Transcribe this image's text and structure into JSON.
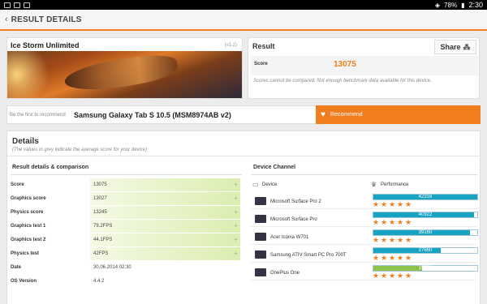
{
  "status": {
    "battery": "78%",
    "time": "2:30"
  },
  "appbar": {
    "title": "RESULT DETAILS"
  },
  "test": {
    "name": "Ice Storm Unlimited",
    "version": "(v1.2)"
  },
  "result": {
    "title": "Result",
    "share_label": "Share",
    "score_label": "Score",
    "score_value": "13075",
    "note": "Scores cannot be compared. Not enough benchmark data available for this device."
  },
  "recommend": {
    "first_text": "Be the first to recommend",
    "device": "Samsung Galaxy Tab S 10.5 (MSM8974AB v2)",
    "button": "Recommend"
  },
  "details": {
    "title": "Details",
    "subtitle": "(The values in grey indicate the average score for your device)",
    "left_heading": "Result details & comparison",
    "right_heading": "Device Channel",
    "rows": [
      {
        "label": "Score",
        "value": "13075",
        "green": true
      },
      {
        "label": "Graphics score",
        "value": "13027",
        "green": true
      },
      {
        "label": "Physics score",
        "value": "13245",
        "green": true
      },
      {
        "label": "Graphics test 1",
        "value": "79.2FPS",
        "green": true
      },
      {
        "label": "Graphics test 2",
        "value": "44.1FPS",
        "green": true
      },
      {
        "label": "Physics test",
        "value": "42FPS",
        "green": true
      },
      {
        "label": "Date",
        "value": "30.06.2014 02:30",
        "green": false
      },
      {
        "label": "OS Version",
        "value": "4.4.2",
        "green": false
      }
    ]
  },
  "device_channel": {
    "col_device": "Device",
    "col_perf": "Performance",
    "items": [
      {
        "name": "Microsoft Surface Pro 2",
        "score": "42316",
        "fill": 1.0,
        "color": "#19a3c2",
        "stars": 5
      },
      {
        "name": "Microsoft Surface Pro",
        "score": "40922",
        "fill": 0.97,
        "color": "#19a3c2",
        "stars": 5
      },
      {
        "name": "Acer Iconia W701",
        "score": "39160",
        "fill": 0.93,
        "color": "#19a3c2",
        "stars": 5
      },
      {
        "name": "Samsung ATIV Smart PC Pro 700T",
        "score": "27660",
        "fill": 0.65,
        "color": "#19a3c2",
        "stars": 5
      },
      {
        "name": "OnePlus One",
        "score": "19750",
        "fill": 0.47,
        "color": "#8ec34a",
        "stars": 5
      }
    ]
  }
}
